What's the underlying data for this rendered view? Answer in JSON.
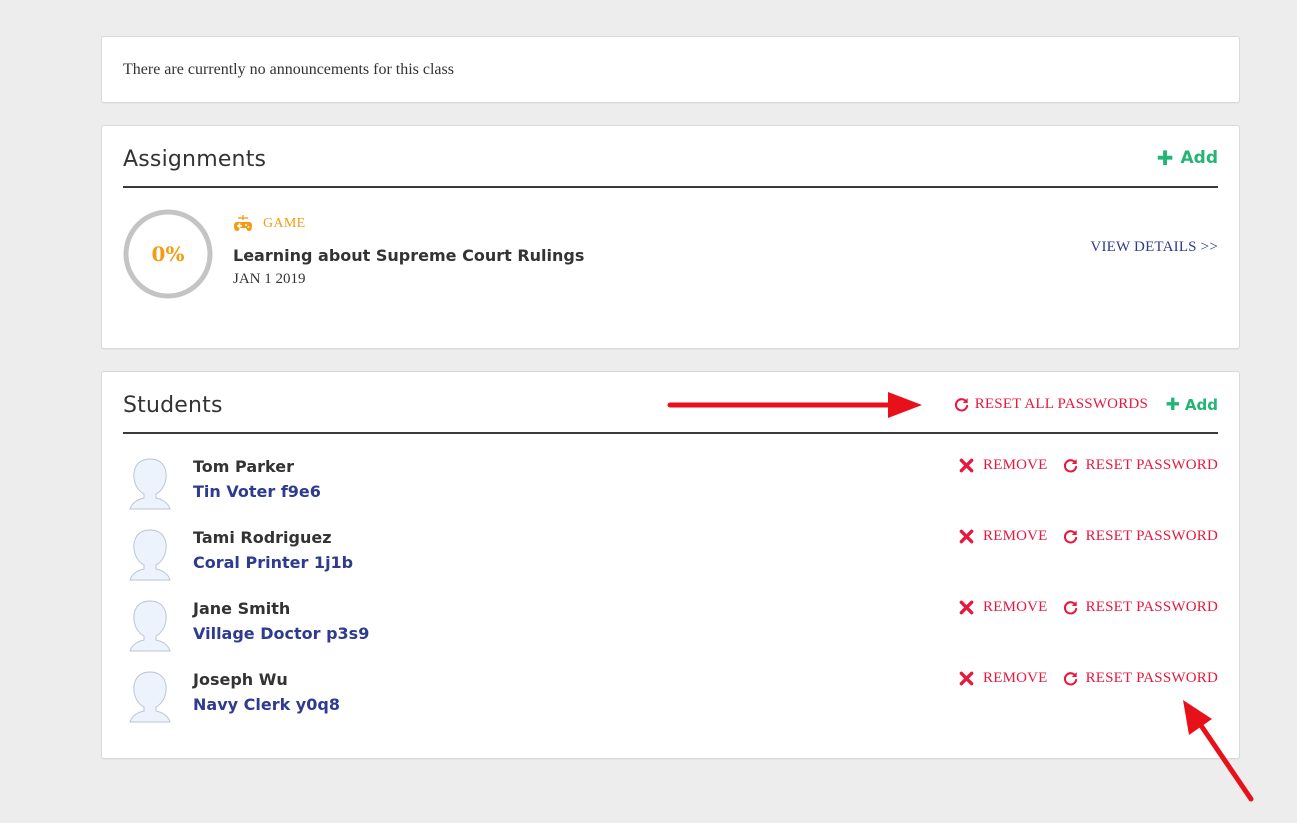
{
  "announcements": {
    "text": "There are currently no announcements for this class"
  },
  "assignments": {
    "title": "Assignments",
    "add_label": "Add",
    "items": [
      {
        "progress": "0%",
        "progress_fraction": 0,
        "type": "GAME",
        "name": "Learning about Supreme Court Rulings",
        "date": "JAN 1 2019",
        "view_label": "VIEW DETAILS >>"
      }
    ]
  },
  "students": {
    "title": "Students",
    "reset_all_label": "RESET ALL PASSWORDS",
    "add_label": "Add",
    "remove_label": "REMOVE",
    "reset_label": "RESET PASSWORD",
    "items": [
      {
        "name": "Tom Parker",
        "username": "Tin Voter f9e6"
      },
      {
        "name": "Tami Rodriguez",
        "username": "Coral Printer 1j1b"
      },
      {
        "name": "Jane Smith",
        "username": "Village Doctor p3s9"
      },
      {
        "name": "Joseph Wu",
        "username": "Navy Clerk y0q8"
      }
    ]
  },
  "colors": {
    "accent_green": "#22b573",
    "danger_red": "#e8173d",
    "progress_orange": "#f39c12",
    "link_blue": "#2e3b8e",
    "annotation_arrow": "#e8111a"
  },
  "icons": {
    "add": "plus-icon",
    "game": "game-controller-icon",
    "remove": "x-icon",
    "reset": "refresh-icon",
    "student": "avatar-icon"
  }
}
